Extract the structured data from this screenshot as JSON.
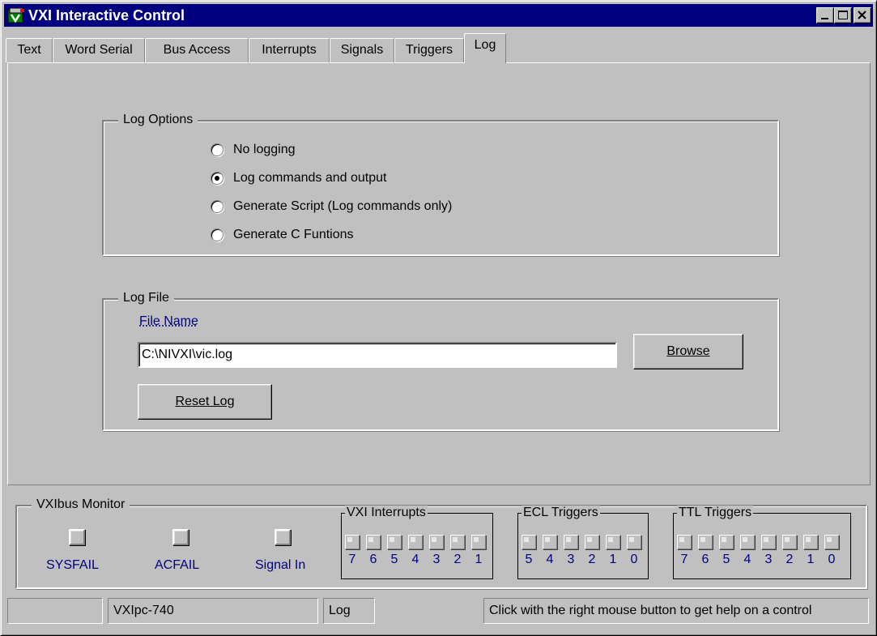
{
  "window": {
    "title": "VXI Interactive Control",
    "icon": "vxi-app-icon",
    "controls": [
      "minimize-icon",
      "maximize-icon",
      "close-icon"
    ]
  },
  "tabs": [
    {
      "label": "Text"
    },
    {
      "label": "Word Serial"
    },
    {
      "label": "Bus Access"
    },
    {
      "label": "Interrupts"
    },
    {
      "label": "Signals"
    },
    {
      "label": "Triggers"
    },
    {
      "label": "Log",
      "active": true
    }
  ],
  "log_options": {
    "legend": "Log Options",
    "options": [
      {
        "label": "No logging",
        "selected": false
      },
      {
        "label": "Log commands and output",
        "selected": true
      },
      {
        "label": "Generate Script (Log commands only)",
        "selected": false
      },
      {
        "label": "Generate C Funtions",
        "selected": false
      }
    ]
  },
  "log_file": {
    "legend": "Log File",
    "file_name_label": "File Name",
    "file_name_value": "C:\\NIVXI\\vic.log",
    "browse_label": "Browse",
    "reset_label": "Reset Log"
  },
  "monitor": {
    "legend": "VXIbus Monitor",
    "leds": [
      {
        "label": "SYSFAIL"
      },
      {
        "label": "ACFAIL"
      },
      {
        "label": "Signal In"
      }
    ],
    "vxi_interrupts": {
      "label": "VXI Interrupts",
      "lines": [
        "7",
        "6",
        "5",
        "4",
        "3",
        "2",
        "1"
      ]
    },
    "ecl_triggers": {
      "label": "ECL Triggers",
      "lines": [
        "5",
        "4",
        "3",
        "2",
        "1",
        "0"
      ]
    },
    "ttl_triggers": {
      "label": "TTL Triggers",
      "lines": [
        "7",
        "6",
        "5",
        "4",
        "3",
        "2",
        "1",
        "0"
      ]
    }
  },
  "status": {
    "panel1": "",
    "device": "VXIpc-740",
    "mode": "Log",
    "help": "Click with the right mouse button to get help on a control"
  },
  "colors": {
    "face": "#c0c0c0",
    "title_bar": "#000080",
    "label_blue": "#000080"
  }
}
